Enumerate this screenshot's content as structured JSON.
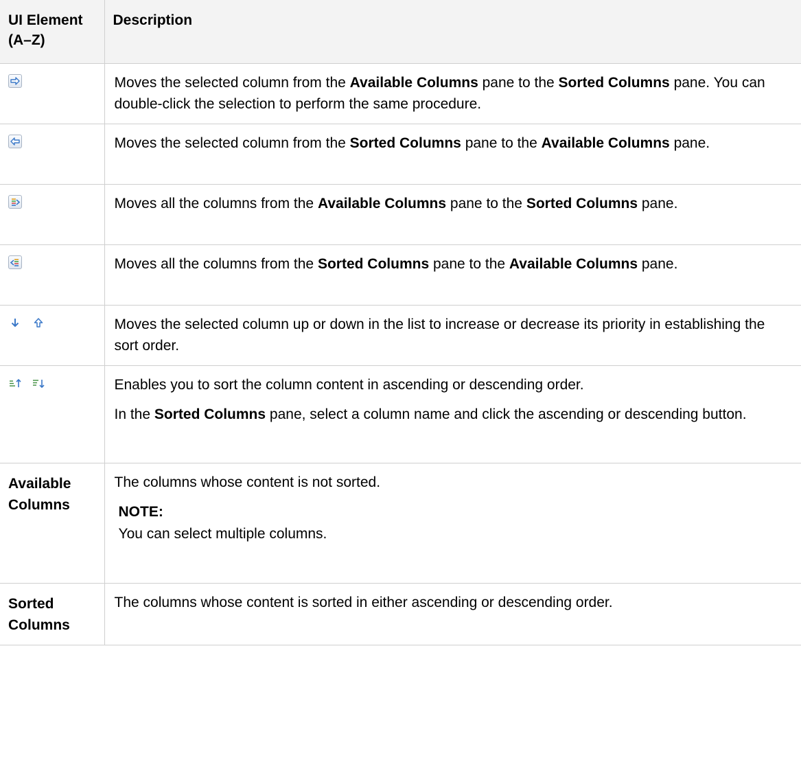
{
  "table": {
    "header": {
      "col1": "UI Element (A–Z)",
      "col2": "Description"
    },
    "rows": [
      {
        "icon": "move-right-arrow-icon",
        "description": [
          {
            "t": "Moves the selected column from the ",
            "b": false
          },
          {
            "t": "Available Columns",
            "b": true
          },
          {
            "t": " pane to the ",
            "b": false
          },
          {
            "t": "Sorted Columns",
            "b": true
          },
          {
            "t": " pane. You can double-click the selection to perform the same procedure.",
            "b": false
          }
        ]
      },
      {
        "icon": "move-left-arrow-icon",
        "description": [
          {
            "t": "Moves the selected column from the ",
            "b": false
          },
          {
            "t": "Sorted Columns",
            "b": true
          },
          {
            "t": " pane to the ",
            "b": false
          },
          {
            "t": "Available Columns",
            "b": true
          },
          {
            "t": " pane.",
            "b": false
          }
        ]
      },
      {
        "icon": "move-all-right-icon",
        "description": [
          {
            "t": "Moves all the columns from the ",
            "b": false
          },
          {
            "t": "Available Columns",
            "b": true
          },
          {
            "t": " pane to the ",
            "b": false
          },
          {
            "t": "Sorted Columns",
            "b": true
          },
          {
            "t": " pane.",
            "b": false
          }
        ]
      },
      {
        "icon": "move-all-left-icon",
        "description": [
          {
            "t": "Moves all the columns from the ",
            "b": false
          },
          {
            "t": "Sorted Columns",
            "b": true
          },
          {
            "t": " pane to the ",
            "b": false
          },
          {
            "t": "Available Columns",
            "b": true
          },
          {
            "t": " pane.",
            "b": false
          }
        ]
      },
      {
        "icon": "move-down-up-icons",
        "description": [
          {
            "t": "Moves the selected column up or down in the list to increase or decrease its priority in establishing the sort order.",
            "b": false
          }
        ]
      },
      {
        "icon": "sort-ascending-descending-icons",
        "description": [
          {
            "t": "Enables you to sort the column content in ascending or descending order.",
            "b": false
          }
        ],
        "description2": [
          {
            "t": "In the ",
            "b": false
          },
          {
            "t": "Sorted Columns",
            "b": true
          },
          {
            "t": " pane, select a column name and click the ascending or descending button.",
            "b": false
          }
        ]
      },
      {
        "element": "Available Columns",
        "description": [
          {
            "t": "The columns whose content is not sorted.",
            "b": false
          }
        ],
        "note_title": "NOTE:",
        "note_text": "You can select multiple columns."
      },
      {
        "element": "Sorted Columns",
        "description": [
          {
            "t": "The columns whose content is sorted in either ascending or descending order.",
            "b": false
          }
        ]
      }
    ]
  }
}
